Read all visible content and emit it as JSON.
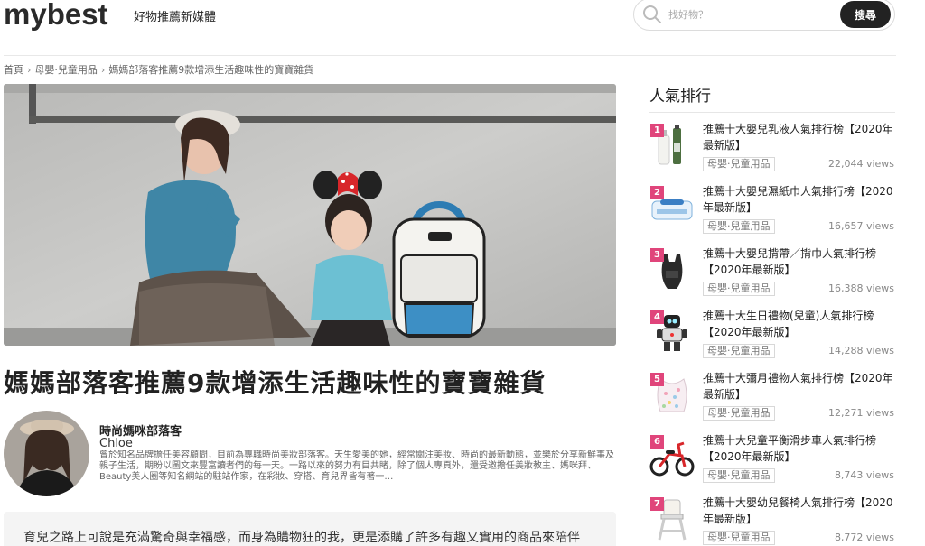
{
  "header": {
    "logo": "mybest",
    "tagline": "好物推薦新媒體",
    "search_placeholder": "找好物？",
    "search_button": "搜尋"
  },
  "breadcrumb": [
    "首頁",
    "母嬰·兒童用品",
    "媽媽部落客推薦9款增添生活趣味性的寶寶雜貨"
  ],
  "article": {
    "title": "媽媽部落客推薦9款增添生活趣味性的寶寶雜貨",
    "author_name": "時尚媽咪部落客",
    "author_handle": "Chloe",
    "author_bio": "曾於知名品牌擔任美容顧問，目前為專職時尚美妝部落客。天生愛美的她，經常關注美妝、時尚的最新動態，並樂於分享新鮮事及親子生活，期盼以圖文來豐富讀者們的每一天。一路以來的努力有目共睹，除了個人專頁外，還受邀擔任美妝教主、媽咪拜、Beauty美人圈等知名網站的駐站作家，在彩妝、穿搭、育兒界皆有著一…",
    "intro": "育兒之路上可說是充滿驚奇與幸福感，而身為購物狂的我，更是添購了許多有趣又實用的商品來陪伴"
  },
  "sidebar": {
    "title": "人氣排行",
    "items": [
      {
        "rank": "1",
        "title": "推薦十大嬰兒乳液人氣排行榜【2020年最新版】",
        "category": "母嬰·兒童用品",
        "views": "22,044 views",
        "icon": "lotion-bottle-icon"
      },
      {
        "rank": "2",
        "title": "推薦十大嬰兒濕紙巾人氣排行榜【2020年最新版】",
        "category": "母嬰·兒童用品",
        "views": "16,657 views",
        "icon": "wet-wipes-icon"
      },
      {
        "rank": "3",
        "title": "推薦十大嬰兒揹帶／揹巾人氣排行榜【2020年最新版】",
        "category": "母嬰·兒童用品",
        "views": "16,388 views",
        "icon": "baby-carrier-icon"
      },
      {
        "rank": "4",
        "title": "推薦十大生日禮物(兒童)人氣排行榜【2020年最新版】",
        "category": "母嬰·兒童用品",
        "views": "14,288 views",
        "icon": "robot-toy-icon"
      },
      {
        "rank": "5",
        "title": "推薦十大彌月禮物人氣排行榜【2020年最新版】",
        "category": "母嬰·兒童用品",
        "views": "12,271 views",
        "icon": "baby-bib-icon"
      },
      {
        "rank": "6",
        "title": "推薦十大兒童平衡滑步車人氣排行榜【2020年最新版】",
        "category": "母嬰·兒童用品",
        "views": "8,743 views",
        "icon": "balance-bike-icon"
      },
      {
        "rank": "7",
        "title": "推薦十大嬰幼兒餐椅人氣排行榜【2020年最新版】",
        "category": "母嬰·兒童用品",
        "views": "8,772 views",
        "icon": "high-chair-icon"
      }
    ]
  }
}
